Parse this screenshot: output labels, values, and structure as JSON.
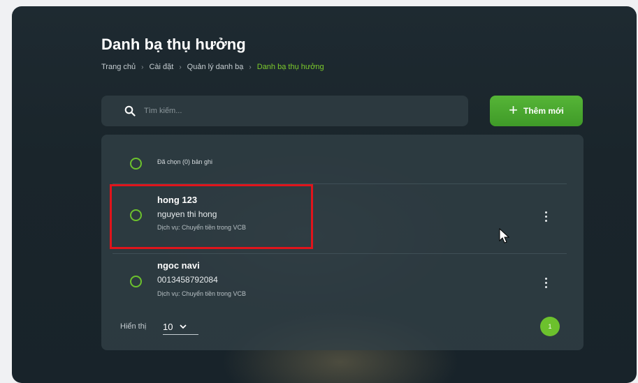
{
  "page": {
    "title": "Danh bạ thụ hưởng"
  },
  "breadcrumb": [
    {
      "label": "Trang chủ"
    },
    {
      "label": "Cài đặt"
    },
    {
      "label": "Quản lý danh bạ"
    },
    {
      "label": "Danh bạ thụ hưởng"
    }
  ],
  "search": {
    "placeholder": "Tìm kiếm...",
    "value": ""
  },
  "add_button": {
    "label": "Thêm mới"
  },
  "selection": {
    "label": "Đã chọn (0) bản ghi"
  },
  "contacts": [
    {
      "name": "hong 123",
      "account": "nguyen thi hong",
      "service": "Dịch vụ: Chuyển tiền trong VCB"
    },
    {
      "name": "ngoc navi",
      "account": "0013458792084",
      "service": "Dịch vụ: Chuyển tiền trong VCB"
    }
  ],
  "footer": {
    "show_label": "Hiển thị",
    "page_size": "10",
    "current_page": "1"
  },
  "colors": {
    "accent": "#6cc12d",
    "active_breadcrumb": "#7ccb2c",
    "button_green": "#4aa82f",
    "highlight_red": "#e0141b",
    "background": "#1c272d"
  },
  "icons": [
    "search-icon",
    "plus-icon",
    "chevron-down-icon",
    "more-vertical-icon",
    "cursor-icon"
  ]
}
